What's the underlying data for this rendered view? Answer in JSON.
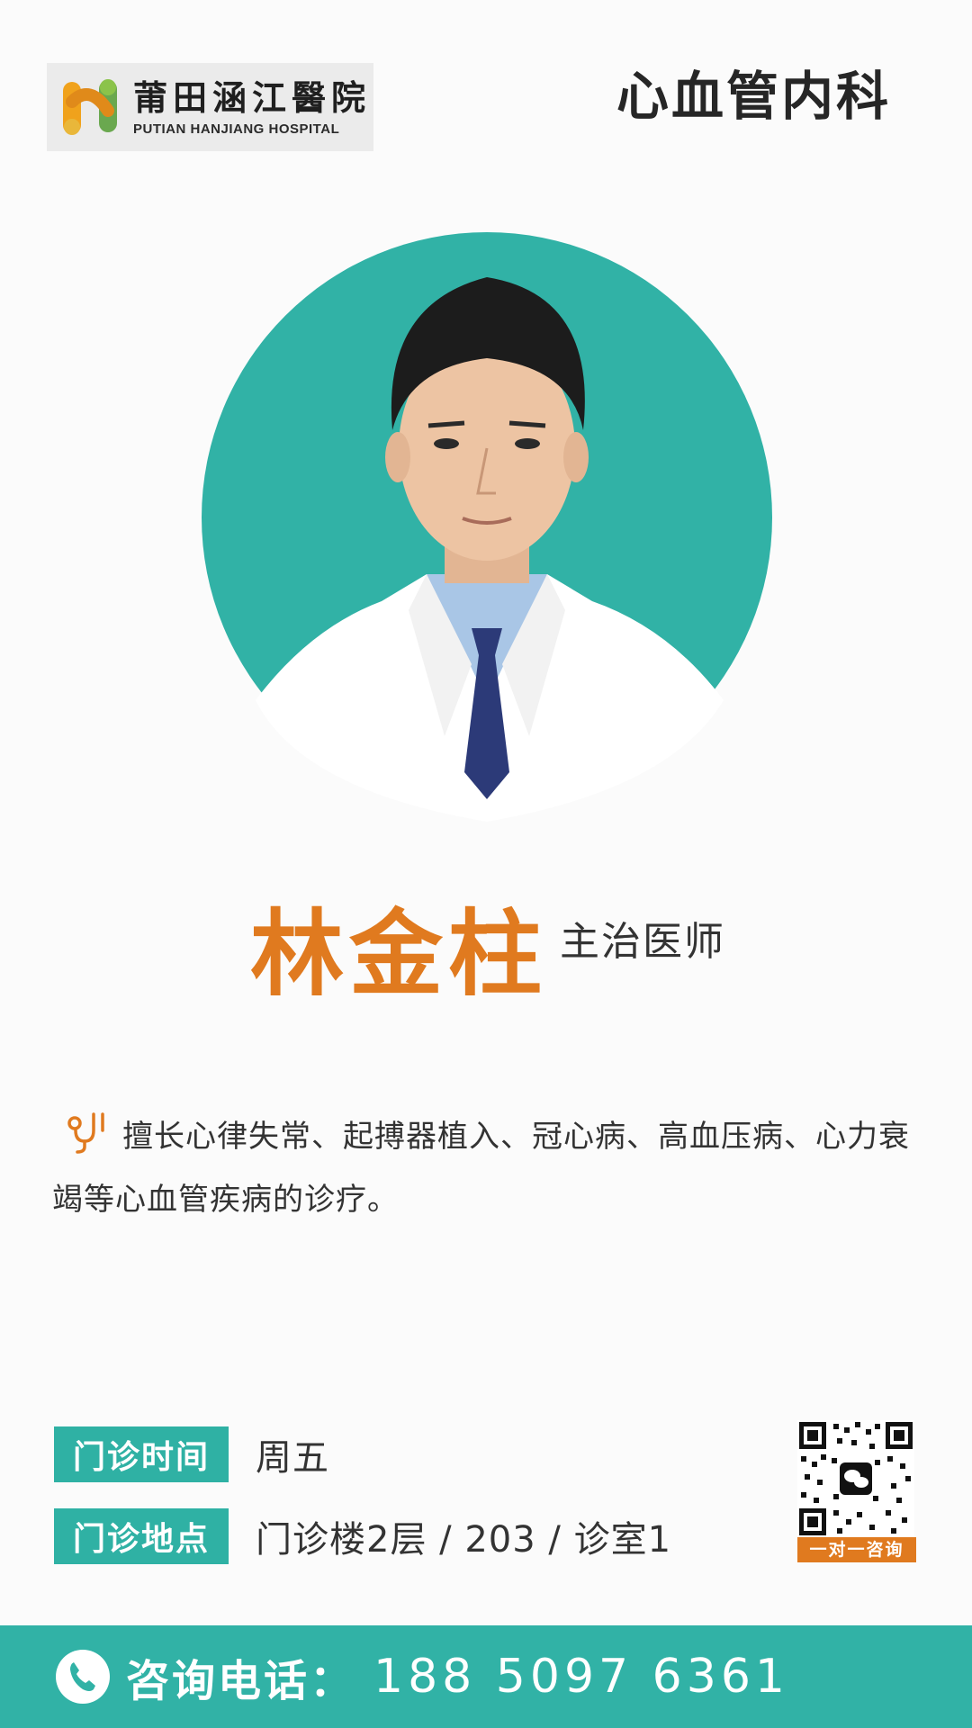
{
  "header": {
    "logo_cn": "莆田涵江醫院",
    "logo_en": "PUTIAN HANJIANG HOSPITAL",
    "department": "心血管内科"
  },
  "doctor": {
    "name": "林金柱",
    "title": "主治医师",
    "expertise": "擅长心律失常、起搏器植入、冠心病、高血压病、心力衰竭等心血管疾病的诊疗。"
  },
  "clinic": {
    "time_label": "门诊时间",
    "time_value": "周五",
    "location_label": "门诊地点",
    "location_value": "门诊楼2层 / 203 / 诊室1"
  },
  "qr": {
    "label": "一对一咨询"
  },
  "footer": {
    "label": "咨询电话：",
    "phone": "188 5097 6361"
  },
  "icons": {
    "logo": "hospital-logo-icon",
    "expertise": "stethoscope-icon",
    "phone": "phone-icon",
    "qr_center": "wechat-icon"
  },
  "colors": {
    "teal": "#31b2a6",
    "orange": "#e07a1f",
    "text": "#333333"
  }
}
